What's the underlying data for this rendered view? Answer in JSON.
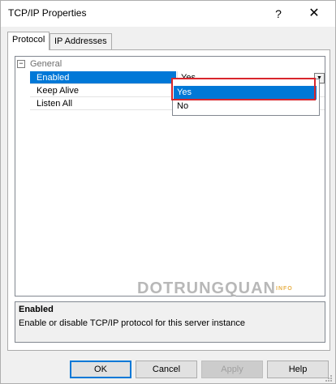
{
  "window": {
    "title": "TCP/IP Properties",
    "help_glyph": "?",
    "close_glyph": "✕"
  },
  "tabs": [
    {
      "label": "Protocol",
      "active": true
    },
    {
      "label": "IP Addresses",
      "active": false
    }
  ],
  "grid": {
    "category": {
      "toggle": "−",
      "label": "General"
    },
    "properties": [
      {
        "name": "Enabled",
        "value": "Yes",
        "selected": true
      },
      {
        "name": "Keep Alive",
        "value": "",
        "selected": false
      },
      {
        "name": "Listen All",
        "value": "",
        "selected": false
      }
    ],
    "dropdown_arrow": "▼",
    "dropdown_options": [
      "Yes",
      "No"
    ],
    "dropdown_highlighted": "Yes"
  },
  "watermark": {
    "text": "DOTRUNGQUAN",
    "suffix": "INFO"
  },
  "description": {
    "title": "Enabled",
    "text": "Enable or disable TCP/IP protocol for this server instance"
  },
  "buttons": {
    "ok": "OK",
    "cancel": "Cancel",
    "apply": "Apply",
    "help": "Help"
  },
  "colors": {
    "selection": "#0078d7",
    "highlight_box": "#d9262c"
  }
}
